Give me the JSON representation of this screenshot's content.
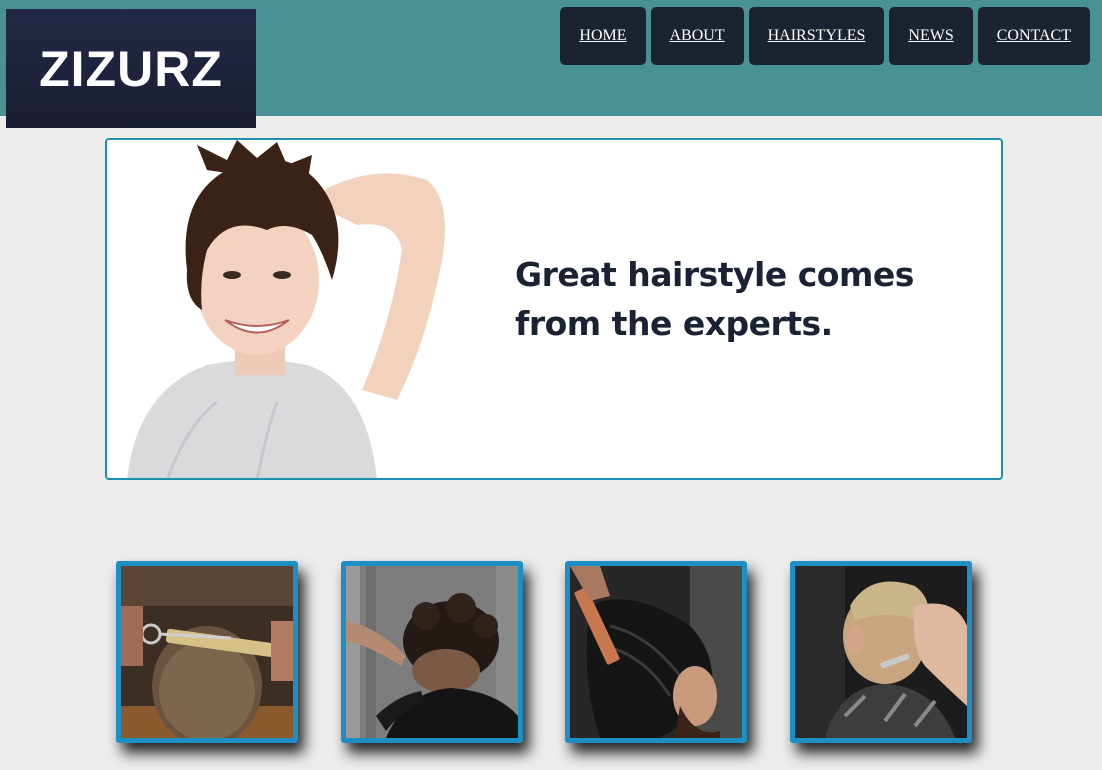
{
  "brand": {
    "logo_text": "ZIZURZ",
    "header_color": "#4a9196",
    "accent": "#1e8fc4"
  },
  "nav": {
    "items": [
      {
        "label": "HOME"
      },
      {
        "label": "ABOUT"
      },
      {
        "label": "HAIRSTYLES"
      },
      {
        "label": "NEWS"
      },
      {
        "label": "CONTACT"
      }
    ]
  },
  "hero": {
    "headline_line1": "Great hairstyle comes",
    "headline_line2": "from the experts.",
    "photo": "smiling-woman-short-hair-photo"
  },
  "gallery": {
    "items": [
      {
        "photo": "barber-scissors-comb-photo"
      },
      {
        "photo": "barber-curly-fade-photo"
      },
      {
        "photo": "barber-combing-long-hair-photo"
      },
      {
        "photo": "barber-neck-shave-photo"
      }
    ]
  }
}
